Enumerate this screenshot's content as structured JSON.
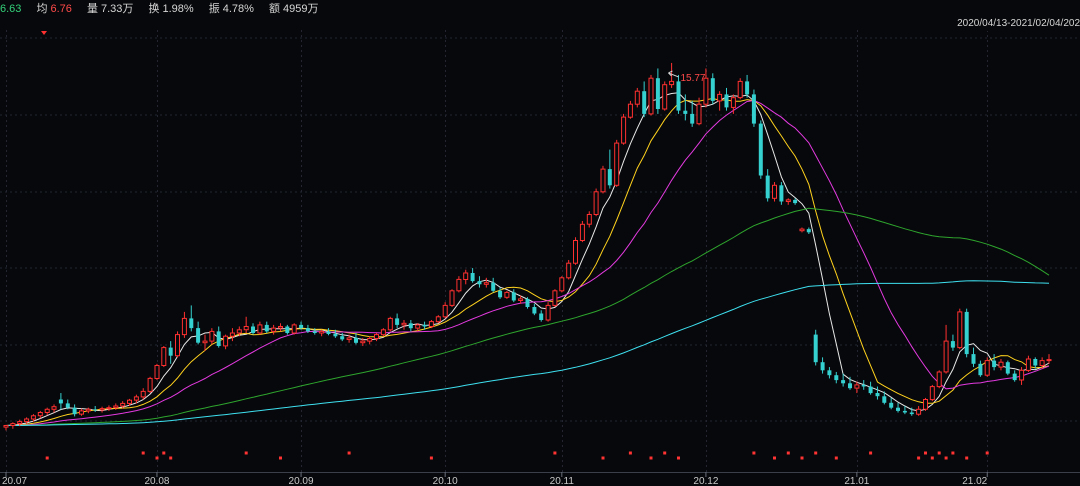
{
  "info": {
    "last_value": "6.63",
    "avg_label": "均",
    "avg_value": "6.76",
    "volume_label": "量",
    "volume_value": "7.33万",
    "turnover_label": "换",
    "turnover_value": "1.98%",
    "amplitude_label": "振",
    "amplitude_value": "4.78%",
    "amount_label": "额",
    "amount_value": "4959万"
  },
  "date_range": "2020/04/13-2021/02/04/202",
  "colors": {
    "background": "#07080b",
    "grid": "#232630",
    "up": "#ff3030",
    "down": "#35d0d0",
    "ma5": "#e8e8e8",
    "ma10": "#ffd21e",
    "ma20": "#e33ae0",
    "ma60": "#2ea52e",
    "ma120": "#3ee0f0",
    "signal": "#ff3333"
  },
  "chart_data": {
    "type": "candlestick",
    "x_ticks": [
      "20.07",
      "20.08",
      "20.09",
      "20.10",
      "20.11",
      "20.12",
      "21.01",
      "21.02"
    ],
    "x_tick_index": [
      0,
      22,
      43,
      64,
      81,
      102,
      124,
      143
    ],
    "peak_label": "15.77",
    "peak_index": 98,
    "ylim": [
      4.4,
      16.6
    ],
    "signal_days": [
      6,
      20,
      22,
      23,
      24,
      35,
      40,
      50,
      62,
      80,
      87,
      91,
      94,
      96,
      98,
      109,
      112,
      114,
      116,
      118,
      121,
      126,
      133,
      134,
      135,
      136,
      137,
      138,
      140,
      143
    ],
    "candles_ohlc": [
      [
        4.55,
        4.62,
        4.45,
        4.6
      ],
      [
        4.6,
        4.7,
        4.5,
        4.66
      ],
      [
        4.66,
        4.78,
        4.58,
        4.72
      ],
      [
        4.72,
        4.85,
        4.65,
        4.8
      ],
      [
        4.8,
        4.95,
        4.72,
        4.9
      ],
      [
        4.9,
        5.05,
        4.82,
        5.0
      ],
      [
        5.0,
        5.15,
        4.92,
        5.1
      ],
      [
        5.1,
        5.25,
        5.0,
        5.18
      ],
      [
        5.4,
        5.6,
        5.1,
        5.28
      ],
      [
        5.28,
        5.4,
        5.1,
        5.15
      ],
      [
        5.15,
        5.25,
        4.88,
        4.95
      ],
      [
        4.95,
        5.12,
        4.9,
        5.05
      ],
      [
        5.05,
        5.15,
        4.98,
        5.1
      ],
      [
        5.1,
        5.2,
        5.02,
        5.08
      ],
      [
        5.08,
        5.18,
        5.0,
        5.12
      ],
      [
        5.12,
        5.22,
        5.05,
        5.15
      ],
      [
        5.15,
        5.28,
        5.08,
        5.2
      ],
      [
        5.2,
        5.35,
        5.12,
        5.28
      ],
      [
        5.28,
        5.42,
        5.2,
        5.38
      ],
      [
        5.38,
        5.55,
        5.28,
        5.48
      ],
      [
        5.48,
        5.75,
        5.4,
        5.65
      ],
      [
        5.65,
        6.1,
        5.6,
        6.05
      ],
      [
        6.05,
        6.5,
        6.0,
        6.45
      ],
      [
        6.45,
        7.05,
        6.4,
        7.0
      ],
      [
        7.0,
        7.2,
        6.5,
        6.75
      ],
      [
        6.75,
        7.5,
        6.7,
        7.4
      ],
      [
        7.4,
        8.1,
        7.3,
        7.9
      ],
      [
        7.9,
        8.3,
        7.5,
        7.6
      ],
      [
        7.6,
        7.8,
        7.1,
        7.15
      ],
      [
        7.15,
        7.4,
        6.9,
        7.2
      ],
      [
        7.2,
        7.6,
        7.1,
        7.5
      ],
      [
        7.5,
        7.65,
        7.0,
        7.05
      ],
      [
        7.05,
        7.4,
        6.95,
        7.35
      ],
      [
        7.35,
        7.6,
        7.2,
        7.45
      ],
      [
        7.45,
        7.65,
        7.35,
        7.55
      ],
      [
        7.55,
        7.95,
        7.45,
        7.65
      ],
      [
        7.65,
        7.75,
        7.4,
        7.45
      ],
      [
        7.45,
        7.8,
        7.4,
        7.7
      ],
      [
        7.7,
        7.8,
        7.45,
        7.5
      ],
      [
        7.5,
        7.7,
        7.4,
        7.6
      ],
      [
        7.6,
        7.75,
        7.5,
        7.65
      ],
      [
        7.65,
        7.7,
        7.4,
        7.45
      ],
      [
        7.45,
        7.75,
        7.4,
        7.7
      ],
      [
        7.7,
        7.8,
        7.55,
        7.6
      ],
      [
        7.6,
        7.7,
        7.45,
        7.5
      ],
      [
        7.5,
        7.6,
        7.4,
        7.45
      ],
      [
        7.45,
        7.55,
        7.35,
        7.5
      ],
      [
        7.5,
        7.6,
        7.38,
        7.42
      ],
      [
        7.42,
        7.55,
        7.3,
        7.35
      ],
      [
        7.35,
        7.45,
        7.2,
        7.25
      ],
      [
        7.25,
        7.4,
        7.15,
        7.3
      ],
      [
        7.3,
        7.45,
        7.1,
        7.15
      ],
      [
        7.15,
        7.3,
        7.05,
        7.2
      ],
      [
        7.2,
        7.35,
        7.1,
        7.28
      ],
      [
        7.28,
        7.45,
        7.2,
        7.4
      ],
      [
        7.4,
        7.6,
        7.35,
        7.55
      ],
      [
        7.55,
        7.95,
        7.5,
        7.9
      ],
      [
        7.9,
        8.05,
        7.6,
        7.7
      ],
      [
        7.7,
        7.85,
        7.55,
        7.75
      ],
      [
        7.75,
        7.85,
        7.5,
        7.6
      ],
      [
        7.6,
        7.75,
        7.5,
        7.7
      ],
      [
        7.7,
        7.8,
        7.55,
        7.65
      ],
      [
        7.65,
        7.85,
        7.6,
        7.8
      ],
      [
        7.8,
        8.0,
        7.75,
        7.95
      ],
      [
        7.95,
        8.4,
        7.9,
        8.3
      ],
      [
        8.3,
        8.8,
        8.25,
        8.75
      ],
      [
        8.75,
        9.2,
        8.7,
        9.1
      ],
      [
        9.1,
        9.4,
        8.95,
        9.3
      ],
      [
        9.3,
        9.45,
        9.0,
        9.05
      ],
      [
        9.05,
        9.2,
        8.85,
        8.95
      ],
      [
        8.95,
        9.15,
        8.85,
        9.0
      ],
      [
        9.0,
        9.15,
        8.7,
        8.75
      ],
      [
        8.75,
        8.85,
        8.5,
        8.55
      ],
      [
        8.55,
        8.75,
        8.5,
        8.7
      ],
      [
        8.7,
        8.8,
        8.4,
        8.45
      ],
      [
        8.45,
        8.6,
        8.35,
        8.5
      ],
      [
        8.5,
        8.55,
        8.2,
        8.25
      ],
      [
        8.25,
        8.35,
        8.0,
        8.05
      ],
      [
        8.05,
        8.15,
        7.8,
        7.85
      ],
      [
        7.85,
        8.4,
        7.8,
        8.3
      ],
      [
        8.3,
        8.8,
        8.25,
        8.75
      ],
      [
        8.75,
        9.2,
        8.7,
        9.15
      ],
      [
        9.15,
        9.7,
        9.1,
        9.6
      ],
      [
        9.6,
        10.4,
        9.55,
        10.3
      ],
      [
        10.3,
        10.9,
        10.25,
        10.8
      ],
      [
        10.8,
        11.2,
        10.7,
        11.1
      ],
      [
        11.1,
        11.9,
        11.05,
        11.8
      ],
      [
        11.8,
        12.6,
        11.75,
        12.5
      ],
      [
        12.5,
        13.1,
        11.9,
        12.0
      ],
      [
        12.0,
        13.4,
        11.95,
        13.3
      ],
      [
        13.3,
        14.2,
        13.25,
        14.1
      ],
      [
        14.1,
        14.6,
        14.05,
        14.5
      ],
      [
        14.5,
        15.0,
        14.4,
        14.9
      ],
      [
        14.9,
        15.2,
        14.1,
        14.2
      ],
      [
        14.2,
        15.4,
        14.15,
        15.3
      ],
      [
        15.3,
        15.6,
        14.2,
        14.35
      ],
      [
        14.35,
        15.2,
        14.3,
        15.1
      ],
      [
        15.1,
        15.77,
        15.0,
        15.2
      ],
      [
        15.2,
        15.4,
        14.2,
        14.3
      ],
      [
        14.3,
        14.8,
        14.0,
        14.2
      ],
      [
        14.2,
        14.6,
        13.8,
        13.9
      ],
      [
        13.9,
        14.7,
        13.85,
        14.5
      ],
      [
        14.5,
        15.6,
        14.4,
        15.3
      ],
      [
        15.3,
        15.45,
        14.5,
        14.6
      ],
      [
        14.6,
        14.9,
        14.3,
        14.8
      ],
      [
        14.8,
        15.0,
        14.3,
        14.4
      ],
      [
        14.4,
        14.8,
        14.2,
        14.7
      ],
      [
        14.7,
        15.3,
        14.65,
        15.2
      ],
      [
        15.2,
        15.4,
        14.7,
        14.8
      ],
      [
        14.8,
        14.95,
        13.8,
        13.9
      ],
      [
        13.9,
        14.0,
        12.2,
        12.3
      ],
      [
        12.3,
        12.5,
        11.5,
        11.6
      ],
      [
        11.6,
        12.1,
        11.5,
        12.0
      ],
      [
        12.0,
        12.1,
        11.4,
        11.5
      ],
      [
        11.5,
        11.6,
        11.4,
        11.55
      ],
      [
        11.55,
        11.6,
        11.4,
        11.45
      ],
      [
        10.6,
        10.7,
        10.55,
        10.65
      ],
      [
        10.65,
        10.7,
        10.5,
        10.55
      ],
      [
        7.4,
        7.55,
        6.45,
        6.55
      ],
      [
        6.55,
        6.7,
        6.2,
        6.3
      ],
      [
        6.3,
        6.4,
        6.05,
        6.15
      ],
      [
        6.15,
        6.25,
        5.9,
        6.0
      ],
      [
        6.0,
        6.2,
        5.8,
        5.9
      ],
      [
        5.9,
        6.1,
        5.7,
        5.75
      ],
      [
        5.75,
        5.95,
        5.6,
        5.85
      ],
      [
        5.85,
        6.0,
        5.7,
        5.8
      ],
      [
        5.8,
        5.95,
        5.55,
        5.6
      ],
      [
        5.6,
        5.8,
        5.4,
        5.5
      ],
      [
        5.5,
        5.65,
        5.25,
        5.3
      ],
      [
        5.3,
        5.45,
        5.1,
        5.15
      ],
      [
        5.15,
        5.3,
        5.0,
        5.05
      ],
      [
        5.05,
        5.2,
        4.95,
        5.0
      ],
      [
        5.0,
        5.15,
        4.9,
        4.95
      ],
      [
        4.95,
        5.2,
        4.9,
        5.1
      ],
      [
        5.1,
        5.45,
        5.05,
        5.4
      ],
      [
        5.4,
        5.85,
        5.35,
        5.8
      ],
      [
        5.8,
        6.3,
        5.75,
        6.25
      ],
      [
        6.25,
        7.7,
        6.2,
        7.2
      ],
      [
        7.2,
        7.4,
        6.9,
        7.0
      ],
      [
        7.0,
        8.2,
        6.95,
        8.1
      ],
      [
        8.1,
        8.2,
        6.7,
        6.8
      ],
      [
        6.8,
        7.0,
        6.4,
        6.5
      ],
      [
        6.5,
        6.6,
        6.1,
        6.15
      ],
      [
        6.15,
        6.7,
        6.1,
        6.6
      ],
      [
        6.6,
        6.8,
        6.3,
        6.4
      ],
      [
        6.4,
        6.65,
        6.3,
        6.55
      ],
      [
        6.55,
        6.6,
        6.15,
        6.2
      ],
      [
        6.2,
        6.3,
        5.95,
        6.0
      ],
      [
        6.0,
        6.4,
        5.85,
        6.3
      ],
      [
        6.3,
        6.75,
        6.25,
        6.65
      ],
      [
        6.65,
        6.7,
        6.35,
        6.45
      ],
      [
        6.45,
        6.7,
        6.35,
        6.6
      ],
      [
        6.6,
        6.8,
        6.5,
        6.63
      ]
    ]
  }
}
